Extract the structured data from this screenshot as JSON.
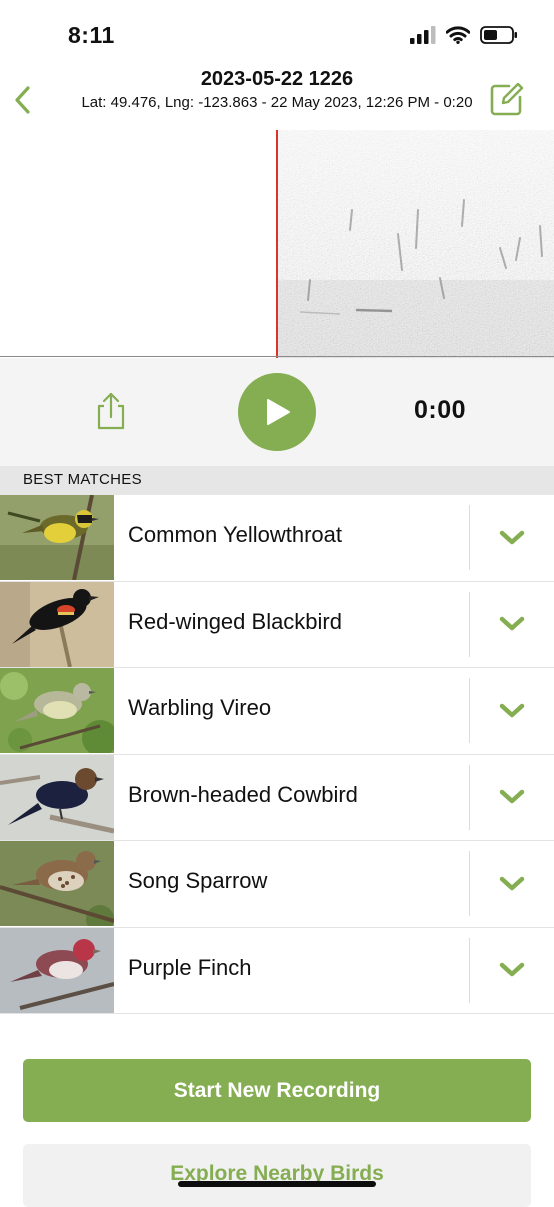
{
  "status_bar": {
    "time": "8:11",
    "icons": [
      "cellular-signal-icon",
      "wifi-icon",
      "battery-icon"
    ]
  },
  "nav": {
    "title": "2023-05-22 1226",
    "subtitle": "Lat: 49.476, Lng: -123.863 - 22 May 2023, 12:26 PM - 0:20",
    "back_icon": "chevron-left-icon",
    "edit_icon": "edit-pencil-square-icon"
  },
  "player": {
    "time": "0:00",
    "share_icon": "share-icon",
    "play_icon": "play-icon",
    "playhead_color": "#d9342b"
  },
  "matches": {
    "header": "BEST MATCHES",
    "items": [
      {
        "name": "Common Yellowthroat"
      },
      {
        "name": "Red-winged Blackbird"
      },
      {
        "name": "Warbling Vireo"
      },
      {
        "name": "Brown-headed Cowbird"
      },
      {
        "name": "Song Sparrow"
      },
      {
        "name": "Purple Finch"
      }
    ],
    "expand_icon": "chevron-down-icon"
  },
  "actions": {
    "start_recording": "Start New Recording",
    "explore_nearby": "Explore Nearby Birds"
  },
  "colors": {
    "accent_green": "#85ad52",
    "section_header_bg": "#e6e6e6",
    "controls_bg": "#f4f4f4"
  }
}
